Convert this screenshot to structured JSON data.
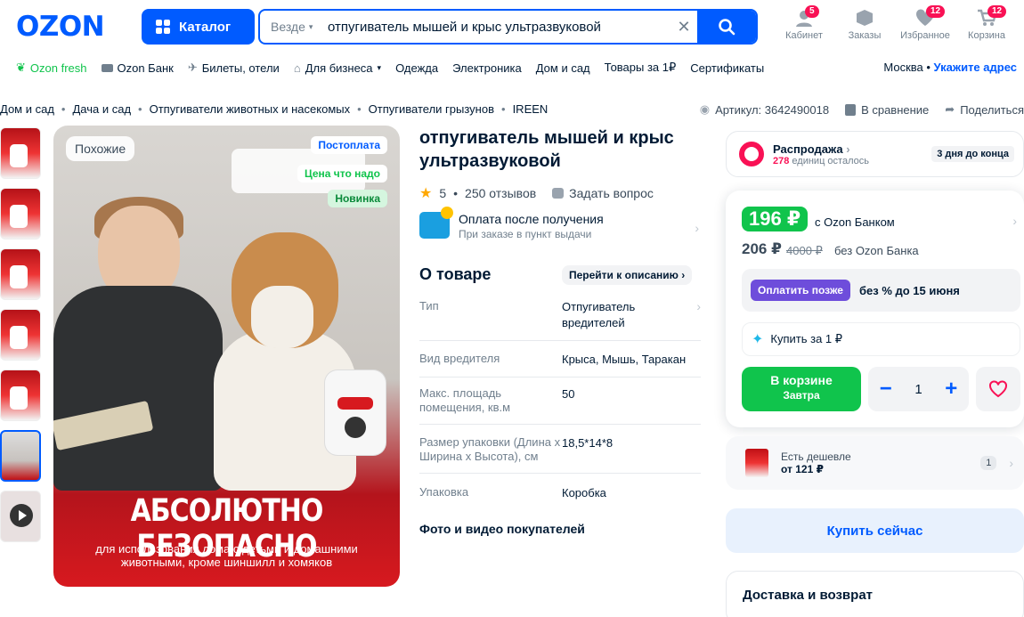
{
  "header": {
    "logo": "OZON",
    "catalog_label": "Каталог",
    "search_scope": "Везде",
    "search_value": "отпугиватель мышей и крыс ультразвуковой",
    "icons": [
      {
        "label": "Кабинет",
        "badge": "5",
        "icon": "user-icon"
      },
      {
        "label": "Заказы",
        "badge": "",
        "icon": "box-icon"
      },
      {
        "label": "Избранное",
        "badge": "12",
        "icon": "heart-icon"
      },
      {
        "label": "Корзина",
        "badge": "12",
        "icon": "cart-icon"
      }
    ]
  },
  "subnav": {
    "items": [
      "Ozon fresh",
      "Ozon Банк",
      "Билеты, отели",
      "Для бизнеса",
      "Одежда",
      "Электроника",
      "Дом и сад",
      "Товары за 1₽",
      "Сертификаты"
    ],
    "city": "Москва",
    "address_link": "Укажите адрес"
  },
  "breadcrumbs": [
    "Дом и сад",
    "Дача и сад",
    "Отпугиватели животных и насекомых",
    "Отпугиватели грызунов",
    "IREEN"
  ],
  "meta": {
    "article": "Артикул: 3642490018",
    "compare": "В сравнение",
    "share": "Поделиться"
  },
  "image": {
    "similar": "Похожие",
    "postpay": "Постоплата",
    "worth": "Цена что надо",
    "new": "Новинка",
    "headline": "АБСОЛЮТНО БЕЗОПАСНО",
    "subtitle": "для использования дома с детьми и домашними животными, кроме шиншилл и хомяков"
  },
  "product": {
    "title": "отпугиватель мышей и крыс ультразвуковой",
    "rating": "5",
    "reviews": "250 отзывов",
    "ask": "Задать вопрос",
    "pay_after": "Оплата после получения",
    "pay_after_sub": "При заказе в пункт выдачи",
    "about": "О товаре",
    "goto_desc": "Перейти к описанию",
    "specs": [
      {
        "k": "Тип",
        "v": "Отпугиватель вредителей"
      },
      {
        "k": "Вид вредителя",
        "v": "Крыса, Мышь, Таракан"
      },
      {
        "k": "Макс. площадь помещения, кв.м",
        "v": "50"
      },
      {
        "k": "Размер упаковки (Длина х Ширина х Высота), см",
        "v": "18,5*14*8"
      },
      {
        "k": "Упаковка",
        "v": "Коробка"
      }
    ],
    "photos": "Фото и видео покупателей"
  },
  "buy": {
    "sale_title": "Распродажа",
    "sale_left_count": "278",
    "sale_left_text": "единиц осталось",
    "sale_days": "3 дня до конца",
    "price_card": "196 ₽",
    "price_card_label": "с Ozon Банком",
    "price_std": "206 ₽",
    "price_old": "4000 ₽",
    "price_std_label": "без Ozon Банка",
    "pay_later_btn": "Оплатить позже",
    "pay_later_text": "без % до 15 июня",
    "buy_for_1": "Купить за 1 ₽",
    "in_cart": "В корзине",
    "in_cart_sub": "Завтра",
    "qty": "1",
    "cheaper_title": "Есть дешевле",
    "cheaper_price": "от 121 ₽",
    "cheaper_count": "1",
    "buy_now": "Купить сейчас",
    "delivery": "Доставка и возврат"
  },
  "colors": {
    "brand": "#005bff",
    "green": "#10c44c",
    "pink": "#f91155",
    "purple": "#6e4ddb"
  }
}
